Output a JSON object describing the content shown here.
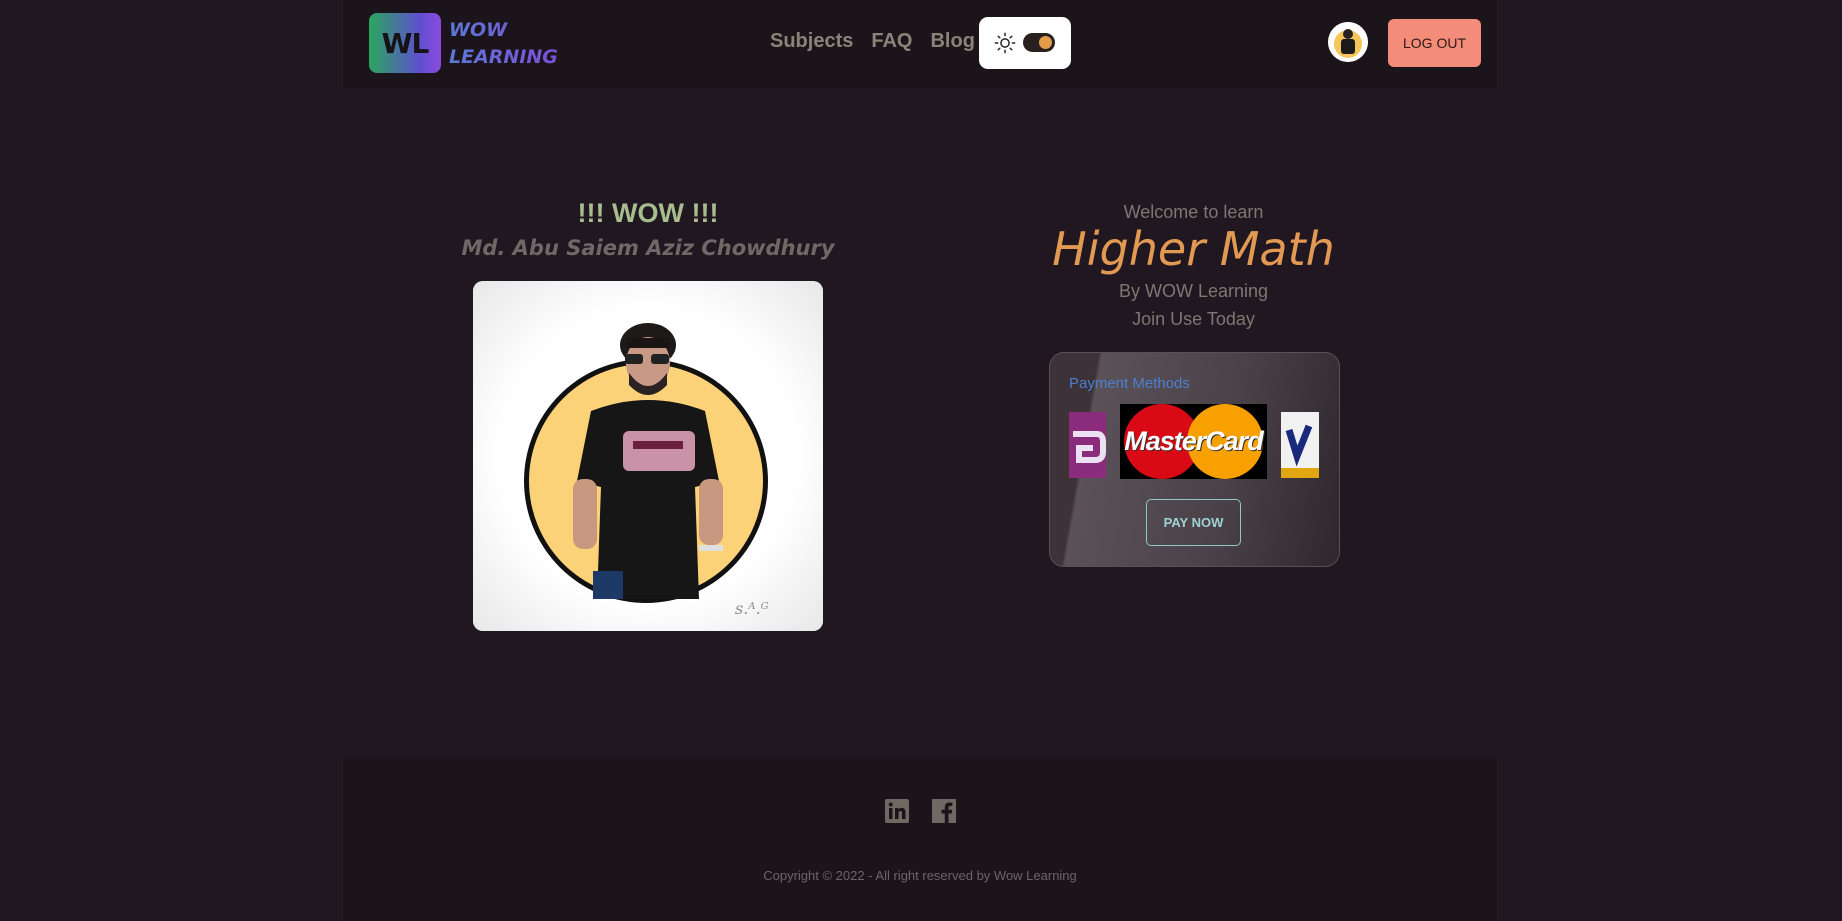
{
  "brand": {
    "initials": "WL",
    "name_line1": "WOW",
    "name_line2": "LEARNING"
  },
  "nav": {
    "links": [
      "Subjects",
      "FAQ",
      "Blog"
    ]
  },
  "theme_toggle": {
    "icon": "sun-icon",
    "state": "dark",
    "knob_color": "#e39c4a"
  },
  "user": {
    "avatar": "user-avatar",
    "logout_label": "LOG OUT"
  },
  "hero_left": {
    "title": "!!! WOW !!!",
    "author": "Md. Abu Saiem Aziz Chowdhury",
    "photo": "profile-photo"
  },
  "hero_right": {
    "welcome": "Welcome to learn",
    "course": "Higher Math",
    "by_line": "By WOW Learning",
    "join_line": "Join Use Today"
  },
  "payment": {
    "label": "Payment Methods",
    "methods": [
      "bkash-logo",
      "mastercard-logo",
      "visa-logo"
    ],
    "mastercard_text": "MasterCard",
    "pay_label": "PAY NOW"
  },
  "footer": {
    "icons": [
      "linkedin-icon",
      "facebook-icon"
    ],
    "copyright": "Copyright © 2022 - All right reserved by Wow Learning"
  },
  "colors": {
    "accent_orange": "#e29a53",
    "logout_bg": "#f48c7a",
    "wow_green": "#a7bd8e",
    "link_blue": "#4c7fd0"
  }
}
